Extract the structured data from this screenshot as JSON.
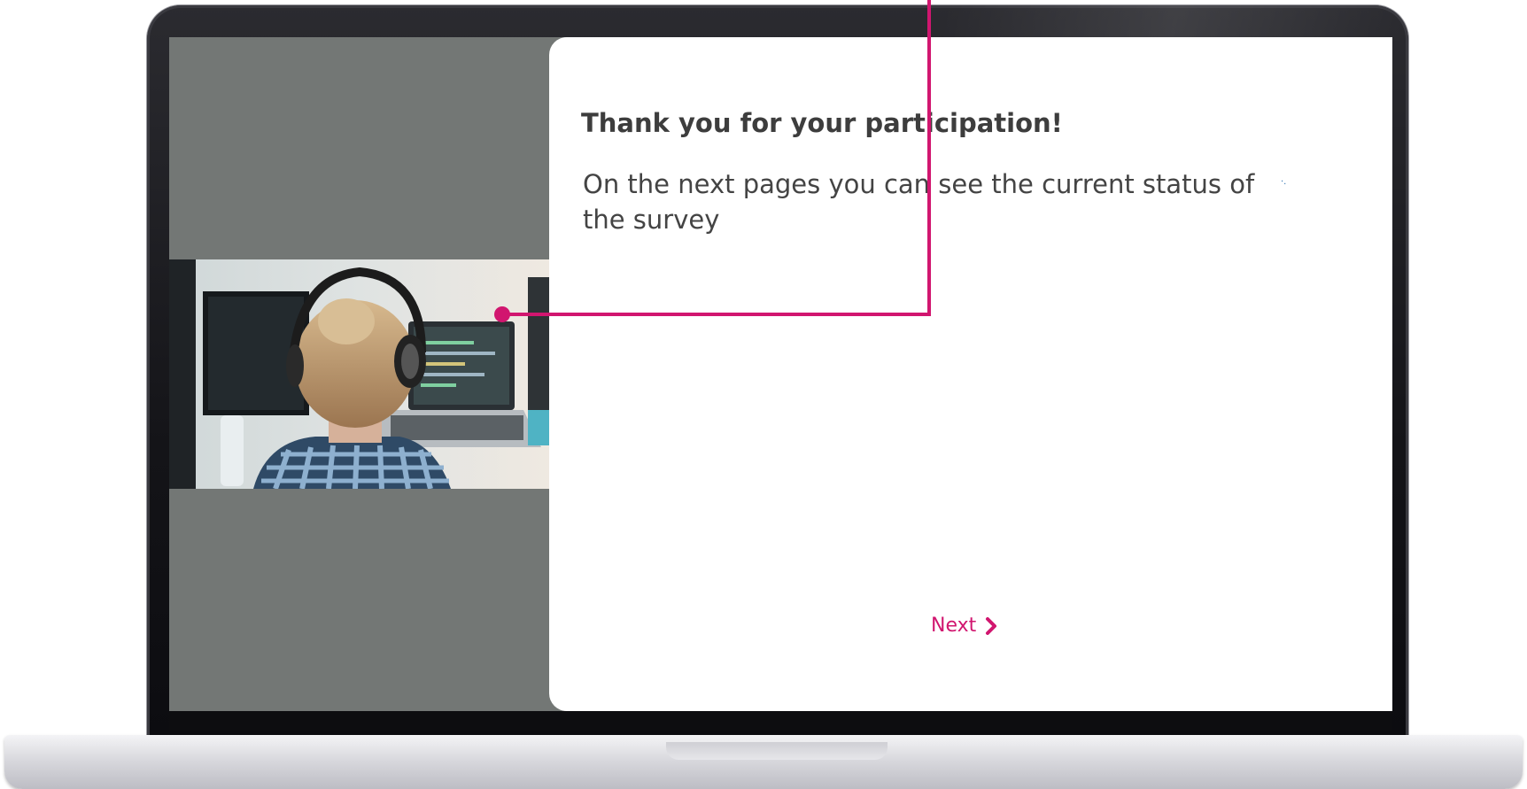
{
  "card": {
    "title": "Thank you for your participation!",
    "text": "On the next pages you can see the current status of the survey",
    "tiny_mark": "·.",
    "next_label": "Next",
    "next_icon": "chevron-right-icon"
  },
  "photo": {
    "description_icon": "person-with-headphones-at-computer-photo"
  },
  "colors": {
    "accent": "#d1166f",
    "panel_gray": "#737775",
    "card_bg": "#ffffff",
    "title_text": "#3d3d3d",
    "body_text": "#444444"
  }
}
